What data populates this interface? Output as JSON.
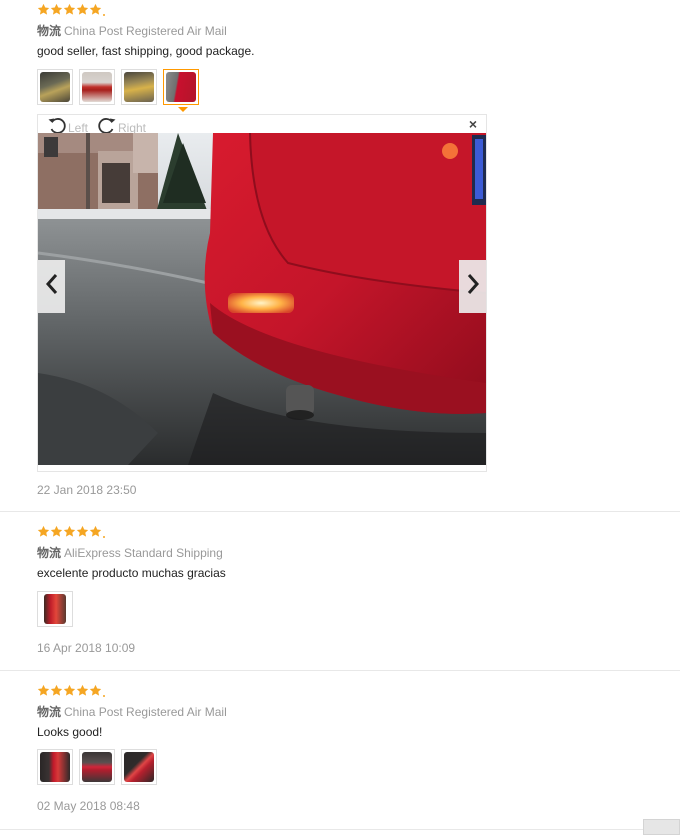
{
  "colors": {
    "star": "#f5a623",
    "active_border": "#ff9900",
    "divider": "#e8e8e8"
  },
  "reviews": [
    {
      "rating": 5,
      "shipping_cn": "物流",
      "shipping": "China Post Registered Air Mail",
      "text": "good seller, fast shipping, good package.",
      "thumb_count": 4,
      "active_thumb": 4,
      "date": "22 Jan 2018 23:50"
    },
    {
      "rating": 5,
      "shipping_cn": "物流",
      "shipping": "AliExpress Standard Shipping",
      "text": "excelente producto muchas gracias",
      "thumb_count": 1,
      "date": "16 Apr 2018 10:09"
    },
    {
      "rating": 5,
      "shipping_cn": "物流",
      "shipping": "China Post Registered Air Mail",
      "text": "Looks good!",
      "thumb_count": 3,
      "date": "02 May 2018 08:48"
    }
  ],
  "viewer": {
    "rotate_left_label": "Left",
    "rotate_right_label": "Right",
    "close_label": "×",
    "icons": {
      "rotate_left": "rotate-left-icon",
      "rotate_right": "rotate-right-icon",
      "close": "close-icon",
      "prev": "chevron-left-icon",
      "next": "chevron-right-icon"
    }
  }
}
